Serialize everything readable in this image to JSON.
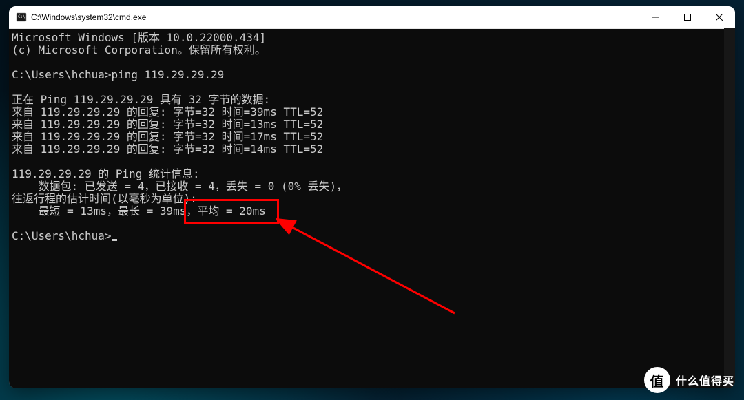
{
  "titlebar": {
    "title": "C:\\Windows\\system32\\cmd.exe"
  },
  "terminal": {
    "lines": [
      "Microsoft Windows [版本 10.0.22000.434]",
      "(c) Microsoft Corporation。保留所有权利。",
      "",
      "C:\\Users\\hchua>ping 119.29.29.29",
      "",
      "正在 Ping 119.29.29.29 具有 32 字节的数据:",
      "来自 119.29.29.29 的回复: 字节=32 时间=39ms TTL=52",
      "来自 119.29.29.29 的回复: 字节=32 时间=13ms TTL=52",
      "来自 119.29.29.29 的回复: 字节=32 时间=17ms TTL=52",
      "来自 119.29.29.29 的回复: 字节=32 时间=14ms TTL=52",
      "",
      "119.29.29.29 的 Ping 统计信息:",
      "    数据包: 已发送 = 4，已接收 = 4，丢失 = 0 (0% 丢失)，",
      "往返行程的估计时间(以毫秒为单位):",
      "    最短 = 13ms，最长 = 39ms，平均 = 20ms",
      "",
      "C:\\Users\\hchua>"
    ]
  },
  "annotation": {
    "highlighted_text": "平均 = 20ms"
  },
  "watermark": {
    "badge": "值",
    "text": "什么值得买"
  }
}
